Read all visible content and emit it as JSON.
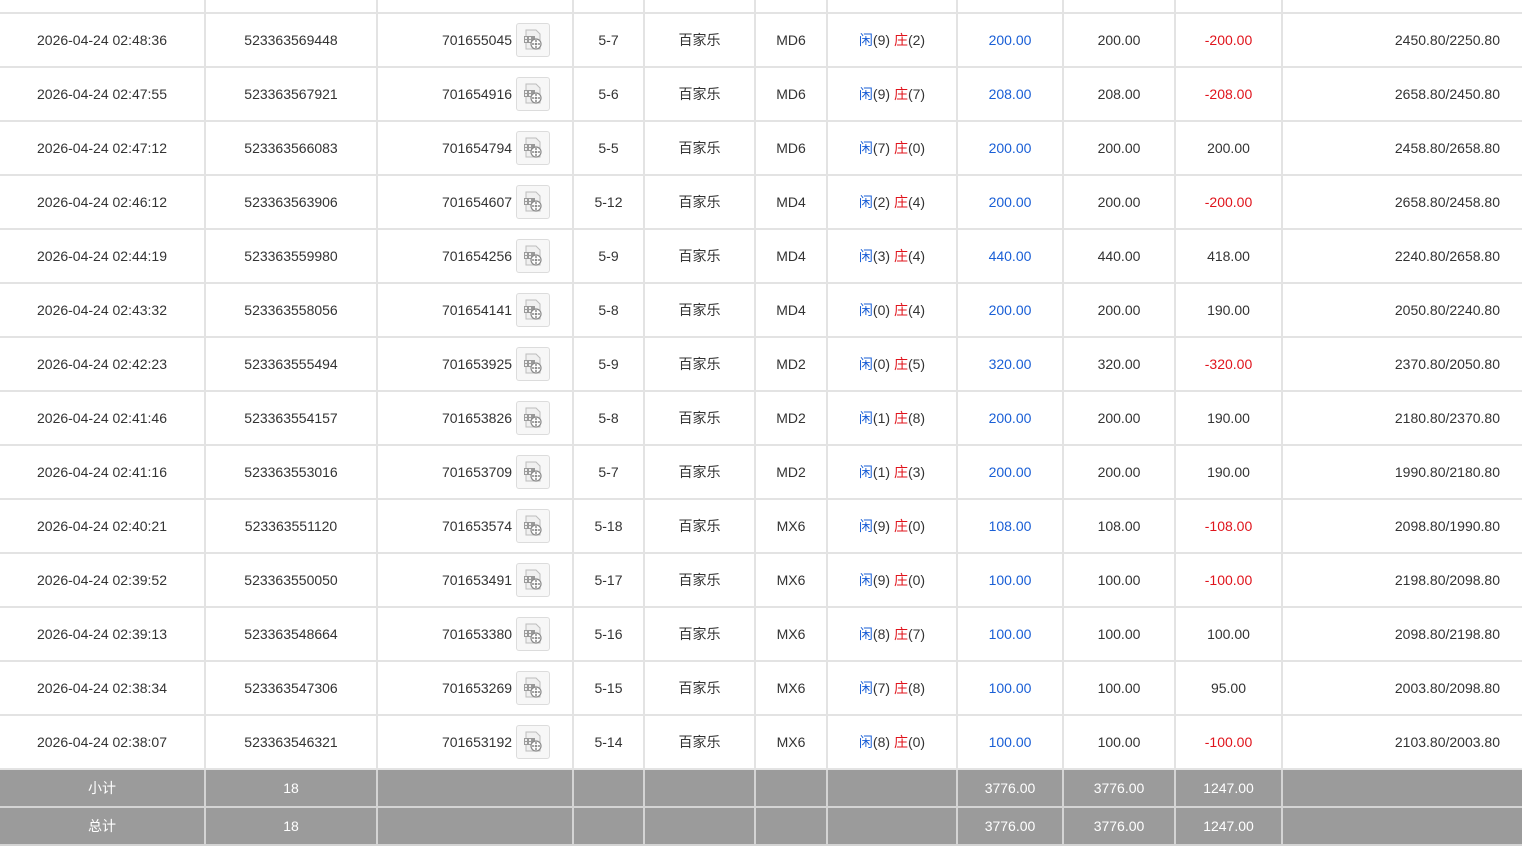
{
  "rows": [
    {
      "time": "",
      "bet_id": "",
      "game_id": "",
      "round": "",
      "game": "",
      "table": "",
      "player_label": "",
      "player_score": "",
      "banker_label": "",
      "banker_score": "",
      "bet": "",
      "valid": "",
      "win": "",
      "win_negative": false,
      "balance": ""
    },
    {
      "time": "2026-04-24 02:48:36",
      "bet_id": "523363569448",
      "game_id": "701655045",
      "round": "5-7",
      "game": "百家乐",
      "table": "MD6",
      "player_label": "闲",
      "player_score": "(9)",
      "banker_label": "庄",
      "banker_score": "(2)",
      "bet": "200.00",
      "valid": "200.00",
      "win": "-200.00",
      "win_negative": true,
      "balance": "2450.80/2250.80"
    },
    {
      "time": "2026-04-24 02:47:55",
      "bet_id": "523363567921",
      "game_id": "701654916",
      "round": "5-6",
      "game": "百家乐",
      "table": "MD6",
      "player_label": "闲",
      "player_score": "(9)",
      "banker_label": "庄",
      "banker_score": "(7)",
      "bet": "208.00",
      "valid": "208.00",
      "win": "-208.00",
      "win_negative": true,
      "balance": "2658.80/2450.80"
    },
    {
      "time": "2026-04-24 02:47:12",
      "bet_id": "523363566083",
      "game_id": "701654794",
      "round": "5-5",
      "game": "百家乐",
      "table": "MD6",
      "player_label": "闲",
      "player_score": "(7)",
      "banker_label": "庄",
      "banker_score": "(0)",
      "bet": "200.00",
      "valid": "200.00",
      "win": "200.00",
      "win_negative": false,
      "balance": "2458.80/2658.80"
    },
    {
      "time": "2026-04-24 02:46:12",
      "bet_id": "523363563906",
      "game_id": "701654607",
      "round": "5-12",
      "game": "百家乐",
      "table": "MD4",
      "player_label": "闲",
      "player_score": "(2)",
      "banker_label": "庄",
      "banker_score": "(4)",
      "bet": "200.00",
      "valid": "200.00",
      "win": "-200.00",
      "win_negative": true,
      "balance": "2658.80/2458.80"
    },
    {
      "time": "2026-04-24 02:44:19",
      "bet_id": "523363559980",
      "game_id": "701654256",
      "round": "5-9",
      "game": "百家乐",
      "table": "MD4",
      "player_label": "闲",
      "player_score": "(3)",
      "banker_label": "庄",
      "banker_score": "(4)",
      "bet": "440.00",
      "valid": "440.00",
      "win": "418.00",
      "win_negative": false,
      "balance": "2240.80/2658.80"
    },
    {
      "time": "2026-04-24 02:43:32",
      "bet_id": "523363558056",
      "game_id": "701654141",
      "round": "5-8",
      "game": "百家乐",
      "table": "MD4",
      "player_label": "闲",
      "player_score": "(0)",
      "banker_label": "庄",
      "banker_score": "(4)",
      "bet": "200.00",
      "valid": "200.00",
      "win": "190.00",
      "win_negative": false,
      "balance": "2050.80/2240.80"
    },
    {
      "time": "2026-04-24 02:42:23",
      "bet_id": "523363555494",
      "game_id": "701653925",
      "round": "5-9",
      "game": "百家乐",
      "table": "MD2",
      "player_label": "闲",
      "player_score": "(0)",
      "banker_label": "庄",
      "banker_score": "(5)",
      "bet": "320.00",
      "valid": "320.00",
      "win": "-320.00",
      "win_negative": true,
      "balance": "2370.80/2050.80"
    },
    {
      "time": "2026-04-24 02:41:46",
      "bet_id": "523363554157",
      "game_id": "701653826",
      "round": "5-8",
      "game": "百家乐",
      "table": "MD2",
      "player_label": "闲",
      "player_score": "(1)",
      "banker_label": "庄",
      "banker_score": "(8)",
      "bet": "200.00",
      "valid": "200.00",
      "win": "190.00",
      "win_negative": false,
      "balance": "2180.80/2370.80"
    },
    {
      "time": "2026-04-24 02:41:16",
      "bet_id": "523363553016",
      "game_id": "701653709",
      "round": "5-7",
      "game": "百家乐",
      "table": "MD2",
      "player_label": "闲",
      "player_score": "(1)",
      "banker_label": "庄",
      "banker_score": "(3)",
      "bet": "200.00",
      "valid": "200.00",
      "win": "190.00",
      "win_negative": false,
      "balance": "1990.80/2180.80"
    },
    {
      "time": "2026-04-24 02:40:21",
      "bet_id": "523363551120",
      "game_id": "701653574",
      "round": "5-18",
      "game": "百家乐",
      "table": "MX6",
      "player_label": "闲",
      "player_score": "(9)",
      "banker_label": "庄",
      "banker_score": "(0)",
      "bet": "108.00",
      "valid": "108.00",
      "win": "-108.00",
      "win_negative": true,
      "balance": "2098.80/1990.80"
    },
    {
      "time": "2026-04-24 02:39:52",
      "bet_id": "523363550050",
      "game_id": "701653491",
      "round": "5-17",
      "game": "百家乐",
      "table": "MX6",
      "player_label": "闲",
      "player_score": "(9)",
      "banker_label": "庄",
      "banker_score": "(0)",
      "bet": "100.00",
      "valid": "100.00",
      "win": "-100.00",
      "win_negative": true,
      "balance": "2198.80/2098.80"
    },
    {
      "time": "2026-04-24 02:39:13",
      "bet_id": "523363548664",
      "game_id": "701653380",
      "round": "5-16",
      "game": "百家乐",
      "table": "MX6",
      "player_label": "闲",
      "player_score": "(8)",
      "banker_label": "庄",
      "banker_score": "(7)",
      "bet": "100.00",
      "valid": "100.00",
      "win": "100.00",
      "win_negative": false,
      "balance": "2098.80/2198.80"
    },
    {
      "time": "2026-04-24 02:38:34",
      "bet_id": "523363547306",
      "game_id": "701653269",
      "round": "5-15",
      "game": "百家乐",
      "table": "MX6",
      "player_label": "闲",
      "player_score": "(7)",
      "banker_label": "庄",
      "banker_score": "(8)",
      "bet": "100.00",
      "valid": "100.00",
      "win": "95.00",
      "win_negative": false,
      "balance": "2003.80/2098.80"
    },
    {
      "time": "2026-04-24 02:38:07",
      "bet_id": "523363546321",
      "game_id": "701653192",
      "round": "5-14",
      "game": "百家乐",
      "table": "MX6",
      "player_label": "闲",
      "player_score": "(8)",
      "banker_label": "庄",
      "banker_score": "(0)",
      "bet": "100.00",
      "valid": "100.00",
      "win": "-100.00",
      "win_negative": true,
      "balance": "2103.80/2003.80"
    }
  ],
  "summary": [
    {
      "label": "小计",
      "count": "18",
      "bet": "3776.00",
      "valid": "3776.00",
      "win": "1247.00"
    },
    {
      "label": "总计",
      "count": "18",
      "bet": "3776.00",
      "valid": "3776.00",
      "win": "1247.00"
    }
  ],
  "colors": {
    "player": "#1a5fd6",
    "banker": "#e0141c",
    "summary_bg": "#9b9b9b",
    "grid": "#e3e3e3"
  },
  "icons": {
    "video": "video-replay-icon"
  }
}
